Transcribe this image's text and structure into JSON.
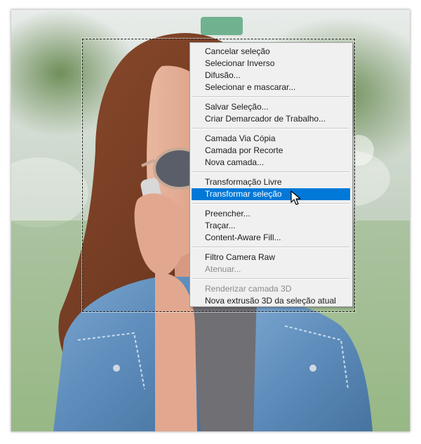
{
  "context_menu": {
    "groups": [
      [
        {
          "label": "Cancelar seleção",
          "enabled": true
        },
        {
          "label": "Selecionar Inverso",
          "enabled": true
        },
        {
          "label": "Difusão...",
          "enabled": true
        },
        {
          "label": "Selecionar e mascarar...",
          "enabled": true
        }
      ],
      [
        {
          "label": "Salvar Seleção...",
          "enabled": true
        },
        {
          "label": "Criar Demarcador de Trabalho...",
          "enabled": true
        }
      ],
      [
        {
          "label": "Camada Via Cópia",
          "enabled": true
        },
        {
          "label": "Camada por Recorte",
          "enabled": true
        },
        {
          "label": "Nova camada...",
          "enabled": true
        }
      ],
      [
        {
          "label": "Transformação Livre",
          "enabled": true
        },
        {
          "label": "Transformar seleção",
          "enabled": true,
          "highlighted": true
        }
      ],
      [
        {
          "label": "Preencher...",
          "enabled": true
        },
        {
          "label": "Traçar...",
          "enabled": true
        },
        {
          "label": "Content-Aware Fill...",
          "enabled": true
        }
      ],
      [
        {
          "label": "Filtro Camera Raw",
          "enabled": true
        },
        {
          "label": "Atenuar...",
          "enabled": false
        }
      ],
      [
        {
          "label": "Renderizar camada 3D",
          "enabled": false
        },
        {
          "label": "Nova extrusão 3D da seleção atual",
          "enabled": true
        }
      ]
    ]
  },
  "colors": {
    "menu_background": "#f0f0f0",
    "highlight": "#0078d7",
    "disabled_text": "#8a8a8a",
    "selection_marquee": "#1a1a1a"
  },
  "icons": {
    "cursor": "arrow-pointer-icon"
  }
}
